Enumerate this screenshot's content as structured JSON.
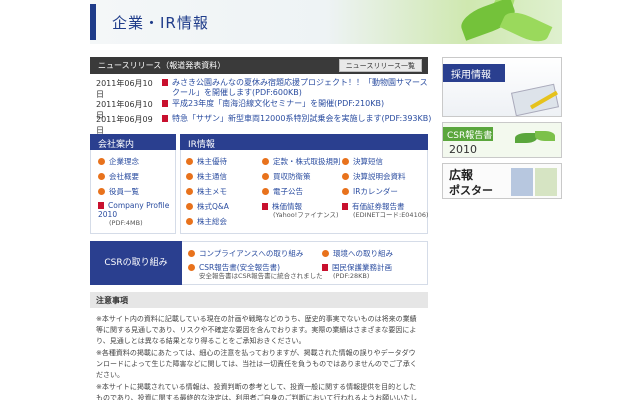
{
  "header": {
    "title": "企業・IR情報"
  },
  "news": {
    "heading": "ニュースリリース（報道発表資料）",
    "list_button": "ニュースリリース一覧",
    "items": [
      {
        "date": "2011年06月10日",
        "text": "みさき公園みんなの夏休み宿題応援プロジェクト！！「動物園サマースクール」を開催します(PDF:600KB)"
      },
      {
        "date": "2011年06月10日",
        "text": "平成23年度「南海沿線文化セミナー」を開催(PDF:210KB)"
      },
      {
        "date": "2011年06月09日",
        "text": "特急「サザン」新型車両12000系特別試乗会を実施します(PDF:393KB)"
      }
    ]
  },
  "company": {
    "heading": "会社案内",
    "links": [
      "企業理念",
      "会社概要",
      "役員一覧"
    ],
    "profile": {
      "label": "Company Profile 2010",
      "size": "(PDF:4MB)"
    }
  },
  "ir": {
    "heading": "IR情報",
    "col1": [
      "株主優待",
      "株主通信",
      "株主メモ",
      "株式Q&A",
      "株主総会"
    ],
    "col2": [
      "定款・株式取扱規則",
      "買収防衛策",
      "電子公告",
      "株価情報"
    ],
    "col2_sub": "(Yahoo!ファイナンス)",
    "col3": [
      "決算短信",
      "決算説明会資料",
      "IRカレンダー",
      "有価証券報告書"
    ],
    "col3_sub": "(EDINETコード:E04106)"
  },
  "csr": {
    "tab": "CSRの取り組み",
    "links": [
      {
        "label": "コンプライアンスへの取り組み"
      },
      {
        "label": "CSR報告書(安全報告書)",
        "sub": "安全報告書はCSR報告書に統合されました"
      },
      {
        "label": "環境への取り組み"
      },
      {
        "label": "国民保護業務計画",
        "sub": "(PDF:28KB)"
      }
    ]
  },
  "notice": {
    "heading": "注意事項",
    "paragraphs": [
      "※本サイト内の資料に記載している現在の計画や戦略などのうち、歴史的事実でないものは将来の業績等に関する見通しであり、リスクや不確定な要因を含んでおります。実際の業績はさまざまな要因により、見通しとは異なる結果となり得ることをご承知おきください。",
      "※各種資料の掲載にあたっては、細心の注意を払っておりますが、掲載された情報の誤りやデータダウンロードによって生じた障害などに関しては、当社は一切責任を負うものではありませんのでご了承ください。",
      "※本サイトに掲載されている情報は、投資判断の参考として、投資一般に関する情報提供を目的としたものであり、投資に関する最終的な決定は、利用者ご自身のご判断において行われるようお願いいたします。"
    ]
  },
  "banners": {
    "recruit": "採用情報",
    "csr_report": "CSR報告書",
    "csr_year": "2010",
    "poster_a": "広報",
    "poster_b": "ポスター"
  },
  "colors": {
    "navy": "#2a3f8f",
    "link": "#2b4da0",
    "orange": "#e8721c",
    "pdf_red": "#c8102e",
    "green": "#5aa63c"
  }
}
